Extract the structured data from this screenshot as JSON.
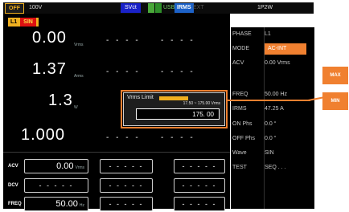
{
  "topbar": {
    "output_state": "OFF",
    "voltage_range": "100V",
    "sense_label": "SVct",
    "usb_label": "USB",
    "irms_label": "IRMS",
    "ext_label": "EXT",
    "power_label": "1P2W"
  },
  "panel": {
    "channel": "L1",
    "waveform_tag": "SIN",
    "readings": [
      {
        "value": "0.00",
        "unit": "Vrms"
      },
      {
        "value": "1.37",
        "unit": "Arms"
      },
      {
        "value": "1.3",
        "unit": "W"
      },
      {
        "value": "1.000",
        "unit": ""
      }
    ],
    "dashes": "- - - -",
    "settings": [
      {
        "label": "ACV",
        "value": "0.00",
        "unit": "Vrms"
      },
      {
        "label": "DCV",
        "value": "",
        "unit": ""
      },
      {
        "label": "FREQ",
        "value": "50.00",
        "unit": "Hz"
      }
    ],
    "box_dashes": "- - - - -"
  },
  "popup": {
    "title": "Vrms Limit",
    "range": "17.50 ~ 175.00 Vrms",
    "value": "175. 00"
  },
  "params": [
    {
      "name": "PHASE",
      "value": "L1",
      "highlight": false
    },
    {
      "name": "MODE",
      "value": "AC-INT",
      "highlight": true
    },
    {
      "name": "ACV",
      "value": "0.00 Vrms",
      "highlight": false
    },
    {
      "name": "",
      "value": "",
      "highlight": false
    },
    {
      "name": "FREQ",
      "value": "50.00 Hz",
      "highlight": false
    },
    {
      "name": "IRMS",
      "value": "47.25 A",
      "highlight": false
    },
    {
      "name": "ON Phs",
      "value": "0.0 °",
      "highlight": false
    },
    {
      "name": "OFF Phs",
      "value": "0.0 °",
      "highlight": false
    },
    {
      "name": "Wave",
      "value": "SIN",
      "highlight": false
    },
    {
      "name": "TEST",
      "value": "SEQ . . .",
      "highlight": false
    }
  ],
  "softkeys": {
    "max": "MAX",
    "min": "MIN"
  },
  "colors": {
    "accent": "#f08030",
    "yellow": "#f0b020",
    "background": "#000000"
  }
}
